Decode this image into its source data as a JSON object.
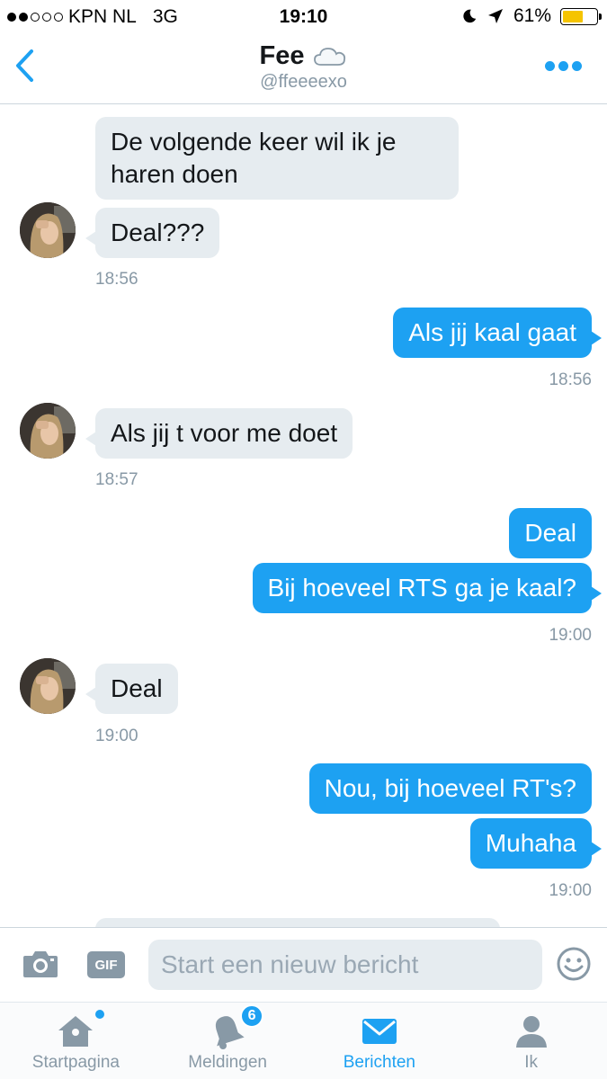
{
  "status_bar": {
    "carrier": "KPN NL",
    "network": "3G",
    "time": "19:10",
    "battery": "61%",
    "battery_level": 0.61,
    "signal_bars_filled": 2,
    "signal_bars_total": 5
  },
  "header": {
    "title": "Fee",
    "handle": "@ffeeeexo",
    "title_icon": "cloud-icon",
    "back_icon": "chevron-left-icon",
    "more_icon": "more-dots-icon"
  },
  "messages": [
    {
      "direction": "in",
      "text_lines": [
        "De volgende keer wil ik je",
        "haren doen"
      ]
    },
    {
      "direction": "in",
      "text": "Deal???"
    },
    {
      "direction": "in",
      "timestamp": "18:56"
    },
    {
      "direction": "out",
      "text": "Als jij kaal gaat"
    },
    {
      "direction": "out",
      "timestamp": "18:56"
    },
    {
      "direction": "in",
      "text": "Als jij t voor me doet"
    },
    {
      "direction": "in",
      "timestamp": "18:57"
    },
    {
      "direction": "out",
      "text": "Deal"
    },
    {
      "direction": "out",
      "text": "Bij hoeveel RTS ga je kaal?"
    },
    {
      "direction": "out",
      "timestamp": "19:00"
    },
    {
      "direction": "in",
      "text": "Deal"
    },
    {
      "direction": "in",
      "timestamp": "19:00"
    },
    {
      "direction": "out",
      "text": "Nou, bij hoeveel RT's?"
    },
    {
      "direction": "out",
      "text": "Muhaha"
    },
    {
      "direction": "out",
      "timestamp": "19:00"
    }
  ],
  "composer": {
    "camera_icon": "camera-icon",
    "gif_label": "GIF",
    "placeholder": "Start een nieuw bericht",
    "emoji_icon": "emoji-icon"
  },
  "tabs": [
    {
      "label": "Startpagina",
      "icon": "home-icon",
      "active": false,
      "new_dot": true
    },
    {
      "label": "Meldingen",
      "icon": "bell-icon",
      "active": false,
      "badge": "6"
    },
    {
      "label": "Berichten",
      "icon": "envelope-icon",
      "active": true
    },
    {
      "label": "Ik",
      "icon": "person-icon",
      "active": false
    }
  ],
  "colors": {
    "accent": "#1da1f2",
    "incoming_bubble": "#e6ecf0",
    "muted_text": "#8899a6",
    "battery": "#f5c400"
  }
}
